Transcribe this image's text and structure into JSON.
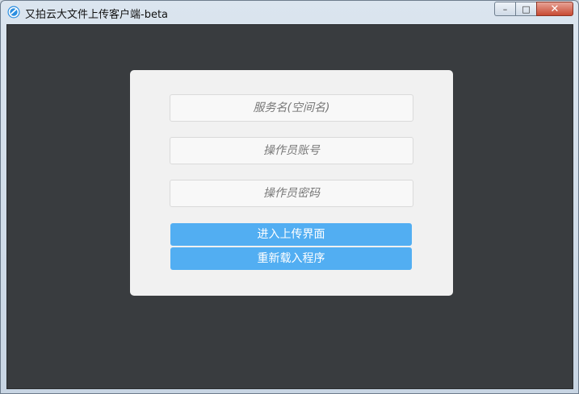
{
  "window": {
    "title": "又拍云大文件上传客户端-beta",
    "controls": {
      "minimize_glyph": "–",
      "maximize_glyph": "□",
      "close_glyph": "✕"
    },
    "app_icon": "upyun-logo-icon"
  },
  "login": {
    "service_name_placeholder": "服务名(空间名)",
    "operator_account_placeholder": "操作员账号",
    "operator_password_placeholder": "操作员密码",
    "enter_button_label": "进入上传界面",
    "reload_button_label": "重新载入程序"
  },
  "colors": {
    "background": "#393c3f",
    "panel": "#f1f1f1",
    "button": "#52aef2",
    "close_button": "#c84a32"
  }
}
